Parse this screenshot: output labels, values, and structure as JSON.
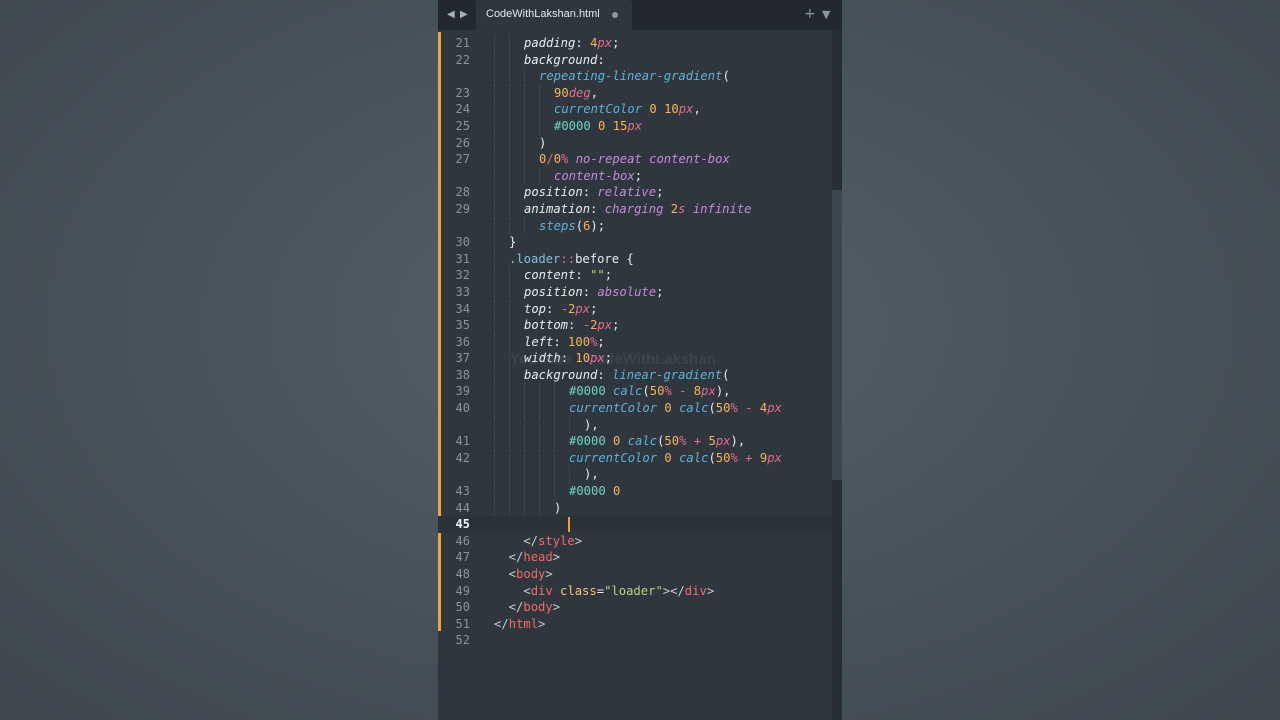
{
  "tab": {
    "title": "CodeWithLakshan.html"
  },
  "icons": {
    "back": "chevron-left-icon",
    "forward": "chevron-right-icon",
    "new_tab": "plus-icon",
    "tab_menu": "chevron-down-icon",
    "modified_dot": "dot-icon"
  },
  "watermark": "YouTube · CodeWithLakshan",
  "colors": {
    "background": "#4a545c",
    "editor_bg": "#2f363d",
    "tabbar_bg": "#22282d",
    "modified_marker": "#f2a532",
    "cursor": "#f0a030"
  },
  "active_line": "45",
  "lines": [
    {
      "n": "21",
      "i": 2,
      "tokens": [
        [
          "prop",
          "padding"
        ],
        [
          "punc",
          ": "
        ],
        [
          "num",
          "4"
        ],
        [
          "unit",
          "px"
        ],
        [
          "punc",
          ";"
        ]
      ]
    },
    {
      "n": "22",
      "i": 2,
      "tokens": [
        [
          "prop",
          "background"
        ],
        [
          "punc",
          ":"
        ]
      ]
    },
    {
      "n": "",
      "i": 3,
      "tokens": [
        [
          "func",
          "repeating-linear-gradient"
        ],
        [
          "punc",
          "("
        ]
      ]
    },
    {
      "n": "23",
      "i": 4,
      "tokens": [
        [
          "num",
          "90"
        ],
        [
          "unit",
          "deg"
        ],
        [
          "punc",
          ","
        ]
      ]
    },
    {
      "n": "24",
      "i": 4,
      "tokens": [
        [
          "func",
          "currentColor"
        ],
        [
          "punc",
          " "
        ],
        [
          "num",
          "0"
        ],
        [
          "punc",
          " "
        ],
        [
          "num",
          "10"
        ],
        [
          "unit",
          "px"
        ],
        [
          "punc",
          ","
        ]
      ]
    },
    {
      "n": "25",
      "i": 4,
      "tokens": [
        [
          "hex",
          "#0000"
        ],
        [
          "punc",
          " "
        ],
        [
          "num",
          "0"
        ],
        [
          "punc",
          " "
        ],
        [
          "num",
          "15"
        ],
        [
          "unit",
          "px"
        ]
      ]
    },
    {
      "n": "26",
      "i": 3,
      "tokens": [
        [
          "punc",
          ")"
        ]
      ]
    },
    {
      "n": "27",
      "i": 3,
      "tokens": [
        [
          "num",
          "0"
        ],
        [
          "op",
          "/"
        ],
        [
          "num",
          "0"
        ],
        [
          "op",
          "%"
        ],
        [
          "punc",
          " "
        ],
        [
          "val",
          "no-repeat"
        ],
        [
          "punc",
          " "
        ],
        [
          "val",
          "content-box"
        ]
      ]
    },
    {
      "n": "",
      "i": 4,
      "tokens": [
        [
          "val",
          "content-box"
        ],
        [
          "punc",
          ";"
        ]
      ]
    },
    {
      "n": "28",
      "i": 2,
      "tokens": [
        [
          "prop",
          "position"
        ],
        [
          "punc",
          ": "
        ],
        [
          "val",
          "relative"
        ],
        [
          "punc",
          ";"
        ]
      ]
    },
    {
      "n": "29",
      "i": 2,
      "tokens": [
        [
          "prop",
          "animation"
        ],
        [
          "punc",
          ": "
        ],
        [
          "val",
          "charging"
        ],
        [
          "punc",
          " "
        ],
        [
          "num",
          "2"
        ],
        [
          "unit",
          "s"
        ],
        [
          "punc",
          " "
        ],
        [
          "val",
          "infinite"
        ]
      ]
    },
    {
      "n": "",
      "i": 3,
      "tokens": [
        [
          "func",
          "steps"
        ],
        [
          "punc",
          "("
        ],
        [
          "num",
          "6"
        ],
        [
          "punc",
          ");"
        ]
      ]
    },
    {
      "n": "30",
      "i": 1,
      "tokens": [
        [
          "punc",
          "}"
        ]
      ]
    },
    {
      "n": "31",
      "i": 1,
      "tokens": [
        [
          "sel",
          ".loader"
        ],
        [
          "op",
          "::"
        ],
        [
          "plain",
          "before"
        ],
        [
          "punc",
          " {"
        ]
      ]
    },
    {
      "n": "32",
      "i": 2,
      "tokens": [
        [
          "prop",
          "content"
        ],
        [
          "punc",
          ": "
        ],
        [
          "str",
          "\"\""
        ],
        [
          "punc",
          ";"
        ]
      ]
    },
    {
      "n": "33",
      "i": 2,
      "tokens": [
        [
          "prop",
          "position"
        ],
        [
          "punc",
          ": "
        ],
        [
          "val",
          "absolute"
        ],
        [
          "punc",
          ";"
        ]
      ]
    },
    {
      "n": "34",
      "i": 2,
      "tokens": [
        [
          "prop",
          "top"
        ],
        [
          "punc",
          ": "
        ],
        [
          "op",
          "-"
        ],
        [
          "num",
          "2"
        ],
        [
          "unit",
          "px"
        ],
        [
          "punc",
          ";"
        ]
      ]
    },
    {
      "n": "35",
      "i": 2,
      "tokens": [
        [
          "prop",
          "bottom"
        ],
        [
          "punc",
          ": "
        ],
        [
          "op",
          "-"
        ],
        [
          "num",
          "2"
        ],
        [
          "unit",
          "px"
        ],
        [
          "punc",
          ";"
        ]
      ]
    },
    {
      "n": "36",
      "i": 2,
      "tokens": [
        [
          "prop",
          "left"
        ],
        [
          "punc",
          ": "
        ],
        [
          "num",
          "100"
        ],
        [
          "op",
          "%"
        ],
        [
          "punc",
          ";"
        ]
      ]
    },
    {
      "n": "37",
      "i": 2,
      "tokens": [
        [
          "prop",
          "width"
        ],
        [
          "punc",
          ": "
        ],
        [
          "num",
          "10"
        ],
        [
          "unit",
          "px"
        ],
        [
          "punc",
          ";"
        ]
      ]
    },
    {
      "n": "38",
      "i": 2,
      "tokens": [
        [
          "prop",
          "background"
        ],
        [
          "punc",
          ": "
        ],
        [
          "func",
          "linear-gradient"
        ],
        [
          "punc",
          "("
        ]
      ]
    },
    {
      "n": "39",
      "i": 5,
      "tokens": [
        [
          "hex",
          "#0000"
        ],
        [
          "punc",
          " "
        ],
        [
          "func",
          "calc"
        ],
        [
          "punc",
          "("
        ],
        [
          "num",
          "50"
        ],
        [
          "op",
          "%"
        ],
        [
          "punc",
          " "
        ],
        [
          "op",
          "-"
        ],
        [
          "punc",
          " "
        ],
        [
          "num",
          "8"
        ],
        [
          "unit",
          "px"
        ],
        [
          "punc",
          "),"
        ]
      ]
    },
    {
      "n": "40",
      "i": 5,
      "tokens": [
        [
          "func",
          "currentColor"
        ],
        [
          "punc",
          " "
        ],
        [
          "num",
          "0"
        ],
        [
          "punc",
          " "
        ],
        [
          "func",
          "calc"
        ],
        [
          "punc",
          "("
        ],
        [
          "num",
          "50"
        ],
        [
          "op",
          "%"
        ],
        [
          "punc",
          " "
        ],
        [
          "op",
          "-"
        ],
        [
          "punc",
          " "
        ],
        [
          "num",
          "4"
        ],
        [
          "unit",
          "px"
        ]
      ]
    },
    {
      "n": "",
      "i": 6,
      "tokens": [
        [
          "punc",
          "),"
        ]
      ]
    },
    {
      "n": "41",
      "i": 5,
      "tokens": [
        [
          "hex",
          "#0000"
        ],
        [
          "punc",
          " "
        ],
        [
          "num",
          "0"
        ],
        [
          "punc",
          " "
        ],
        [
          "func",
          "calc"
        ],
        [
          "punc",
          "("
        ],
        [
          "num",
          "50"
        ],
        [
          "op",
          "%"
        ],
        [
          "punc",
          " "
        ],
        [
          "op",
          "+"
        ],
        [
          "punc",
          " "
        ],
        [
          "num",
          "5"
        ],
        [
          "unit",
          "px"
        ],
        [
          "punc",
          "),"
        ]
      ]
    },
    {
      "n": "42",
      "i": 5,
      "tokens": [
        [
          "func",
          "currentColor"
        ],
        [
          "punc",
          " "
        ],
        [
          "num",
          "0"
        ],
        [
          "punc",
          " "
        ],
        [
          "func",
          "calc"
        ],
        [
          "punc",
          "("
        ],
        [
          "num",
          "50"
        ],
        [
          "op",
          "%"
        ],
        [
          "punc",
          " "
        ],
        [
          "op",
          "+"
        ],
        [
          "punc",
          " "
        ],
        [
          "num",
          "9"
        ],
        [
          "unit",
          "px"
        ]
      ]
    },
    {
      "n": "",
      "i": 6,
      "tokens": [
        [
          "punc",
          "),"
        ]
      ]
    },
    {
      "n": "43",
      "i": 5,
      "tokens": [
        [
          "hex",
          "#0000"
        ],
        [
          "punc",
          " "
        ],
        [
          "num",
          "0"
        ]
      ]
    },
    {
      "n": "44",
      "i": 4,
      "tokens": [
        [
          "punc",
          ")"
        ]
      ]
    },
    {
      "n": "45",
      "i": 0,
      "tokens": []
    },
    {
      "n": "46",
      "i": 0,
      "tokens": [
        [
          "brk",
          "    </"
        ],
        [
          "tag",
          "style"
        ],
        [
          "brk",
          ">"
        ]
      ]
    },
    {
      "n": "47",
      "i": 0,
      "tokens": [
        [
          "brk",
          "  </"
        ],
        [
          "tag",
          "head"
        ],
        [
          "brk",
          ">"
        ]
      ]
    },
    {
      "n": "48",
      "i": 0,
      "tokens": [
        [
          "brk",
          "  <"
        ],
        [
          "tag",
          "body"
        ],
        [
          "brk",
          ">"
        ]
      ]
    },
    {
      "n": "49",
      "i": 0,
      "tokens": [
        [
          "brk",
          "    <"
        ],
        [
          "tag",
          "div"
        ],
        [
          "plain",
          " "
        ],
        [
          "attr",
          "class"
        ],
        [
          "plain",
          "="
        ],
        [
          "str",
          "\"loader\""
        ],
        [
          "brk",
          "></"
        ],
        [
          "tag",
          "div"
        ],
        [
          "brk",
          ">"
        ]
      ]
    },
    {
      "n": "50",
      "i": 0,
      "tokens": [
        [
          "brk",
          "  </"
        ],
        [
          "tag",
          "body"
        ],
        [
          "brk",
          ">"
        ]
      ]
    },
    {
      "n": "51",
      "i": 0,
      "tokens": [
        [
          "brk",
          "</"
        ],
        [
          "tag",
          "html"
        ],
        [
          "brk",
          ">"
        ]
      ]
    },
    {
      "n": "52",
      "i": 0,
      "tokens": []
    }
  ]
}
